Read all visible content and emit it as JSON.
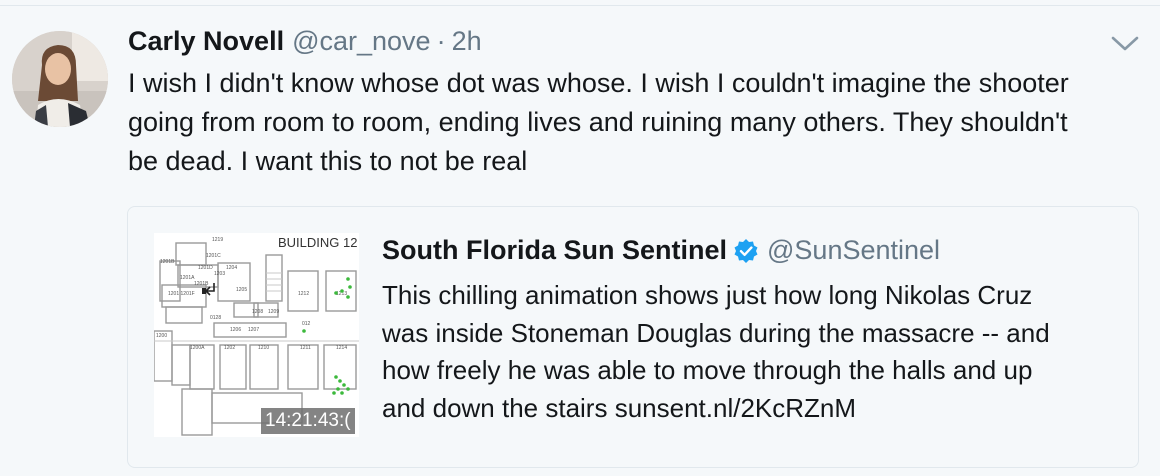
{
  "tweet": {
    "name": "Carly Novell",
    "handle": "@car_nove",
    "separator": "·",
    "time": "2h",
    "text": "I wish I didn't know whose dot was whose. I wish I couldn't imagine the shooter\ngoing from room to room, ending lives and ruining many others. They shouldn't\nbe dead. I want this to not be real"
  },
  "quoted": {
    "name": "South Florida Sun Sentinel",
    "handle": "@SunSentinel",
    "text": "This chilling animation shows just how long Nikolas Cruz\nwas inside Stoneman Douglas during the massacre -- and\nhow freely he was able to move through the halls and up\nand down the stairs sunsent.nl/2KcRZnM",
    "thumbnail": {
      "building_label": "BUILDING 12",
      "timestamp": "14:21:43:(",
      "rooms": [
        "1219",
        "1201C",
        "1201D",
        "1201A",
        "1201B",
        "1201",
        "1201F",
        "1203",
        "1204",
        "1205",
        "1206",
        "1207",
        "1208",
        "1209",
        "1200",
        "1200A",
        "1202",
        "1210",
        "1211",
        "1212",
        "1213",
        "1214",
        "012",
        "0128",
        "1200B"
      ]
    },
    "verified_color": "#1da1f2"
  },
  "icons": {
    "caret": "chevron-down-icon",
    "verified": "verified-badge-icon"
  },
  "colors": {
    "background": "#f5f8fa",
    "text": "#14171a",
    "secondary": "#657786",
    "border": "#e1e8ed",
    "dot_green": "#3cb93c"
  }
}
